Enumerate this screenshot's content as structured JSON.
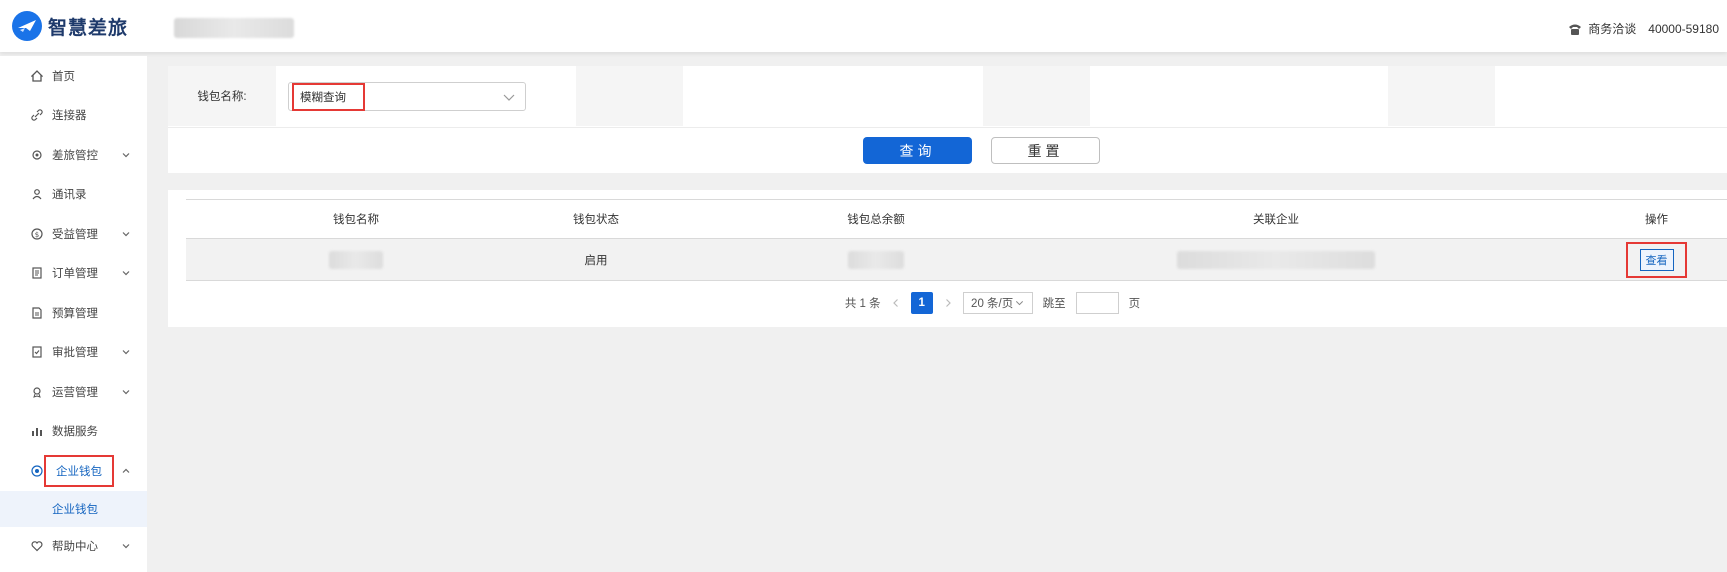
{
  "header": {
    "brand": "智慧差旅",
    "contact_label": "商务洽谈",
    "contact_phone": "40000-59180"
  },
  "sidebar": {
    "items": [
      {
        "label": "首页",
        "icon": "home-icon",
        "chevron": false
      },
      {
        "label": "连接器",
        "icon": "link-icon",
        "chevron": false
      },
      {
        "label": "差旅管控",
        "icon": "settings-icon",
        "chevron": true
      },
      {
        "label": "通讯录",
        "icon": "contacts-icon",
        "chevron": false
      },
      {
        "label": "受益管理",
        "icon": "dollar-icon",
        "chevron": true
      },
      {
        "label": "订单管理",
        "icon": "order-icon",
        "chevron": true
      },
      {
        "label": "预算管理",
        "icon": "budget-icon",
        "chevron": false
      },
      {
        "label": "审批管理",
        "icon": "approval-icon",
        "chevron": true
      },
      {
        "label": "运营管理",
        "icon": "operation-icon",
        "chevron": true
      },
      {
        "label": "数据服务",
        "icon": "chart-icon",
        "chevron": false
      },
      {
        "label": "企业钱包",
        "icon": "wallet-icon",
        "chevron": true,
        "active": true
      }
    ],
    "sub_item": "企业钱包",
    "last_item": {
      "label": "帮助中心",
      "icon": "heart-icon"
    }
  },
  "search": {
    "label": "钱包名称:",
    "placeholder": "模糊查询",
    "query_button": "查询",
    "reset_button": "重置"
  },
  "table": {
    "columns": [
      "钱包名称",
      "钱包状态",
      "钱包总余额",
      "关联企业",
      "操作"
    ],
    "rows": [
      {
        "status": "启用",
        "action": "查看"
      }
    ]
  },
  "pagination": {
    "total": "共 1 条",
    "current_page": "1",
    "page_size": "20 条/页",
    "jump_label": "跳至",
    "page_suffix": "页"
  },
  "colors": {
    "primary": "#1366d6",
    "highlight": "#e53935",
    "brand_text": "#1e3a6b"
  }
}
